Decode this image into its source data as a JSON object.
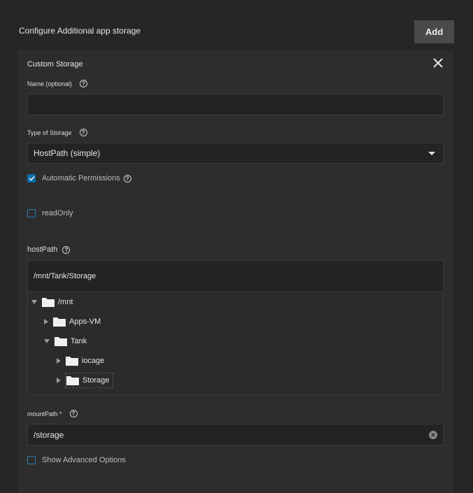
{
  "header": {
    "title": "Configure Additional app storage",
    "add_label": "Add"
  },
  "card": {
    "title": "Custom Storage"
  },
  "name_field": {
    "label": "Name (optional)",
    "value": ""
  },
  "storage_type": {
    "label": "Type of Storage",
    "selected": "HostPath (simple)"
  },
  "auto_permissions": {
    "label": "Automatic Permissions",
    "checked": true
  },
  "read_only": {
    "label": "readOnly",
    "checked": false
  },
  "host_path": {
    "label": "hostPath",
    "value": "/mnt/Tank/Storage",
    "tree": [
      {
        "label": "/mnt",
        "expanded": true
      },
      {
        "label": "Apps-VM",
        "expanded": false
      },
      {
        "label": "Tank",
        "expanded": true
      },
      {
        "label": "iocage",
        "expanded": false
      },
      {
        "label": "Storage",
        "expanded": false,
        "selected": true
      }
    ]
  },
  "mount_path": {
    "label": "mountPath *",
    "value": "/storage"
  },
  "advanced": {
    "label": "Show Advanced Options",
    "checked": false
  },
  "colors": {
    "accent": "#0f6fa8",
    "background": "#262626",
    "card": "#2d2d2d"
  }
}
